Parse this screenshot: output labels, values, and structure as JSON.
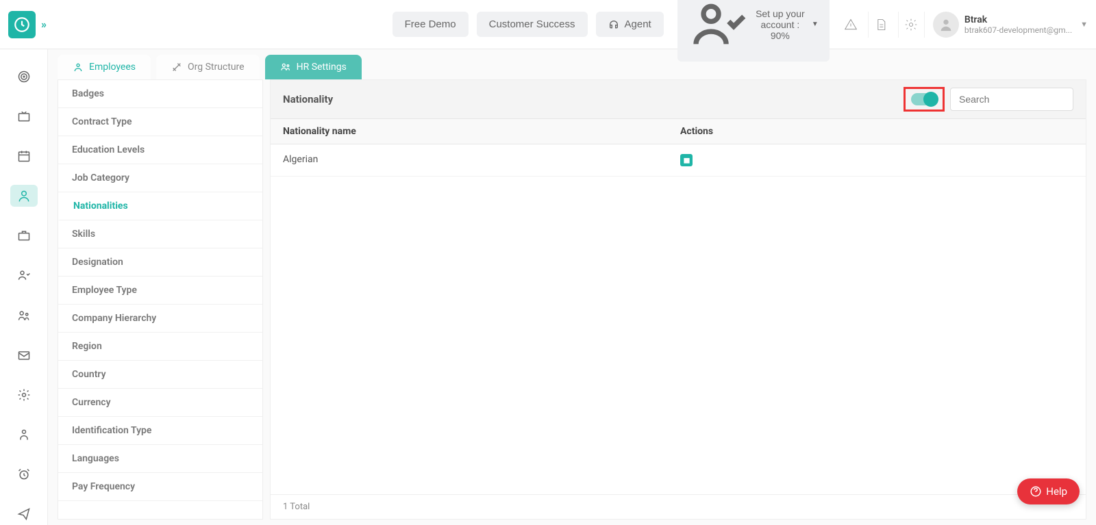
{
  "header": {
    "free_demo": "Free Demo",
    "customer_success": "Customer Success",
    "agent": "Agent",
    "setup_account": "Set up your account : 90%",
    "user_name": "Btrak",
    "user_email": "btrak607-development@gm..."
  },
  "tabs": {
    "employees": "Employees",
    "org_structure": "Org Structure",
    "hr_settings": "HR Settings"
  },
  "sidebar": {
    "items": [
      "Badges",
      "Contract Type",
      "Education Levels",
      "Job Category",
      "Nationalities",
      "Skills",
      "Designation",
      "Employee Type",
      "Company Hierarchy",
      "Region",
      "Country",
      "Currency",
      "Identification Type",
      "Languages",
      "Pay Frequency"
    ],
    "active_index": 4
  },
  "panel": {
    "title": "Nationality",
    "search_placeholder": "Search",
    "col_name": "Nationality name",
    "col_actions": "Actions",
    "rows": [
      {
        "name": "Algerian"
      }
    ],
    "footer": "1 Total"
  },
  "help_label": "Help"
}
